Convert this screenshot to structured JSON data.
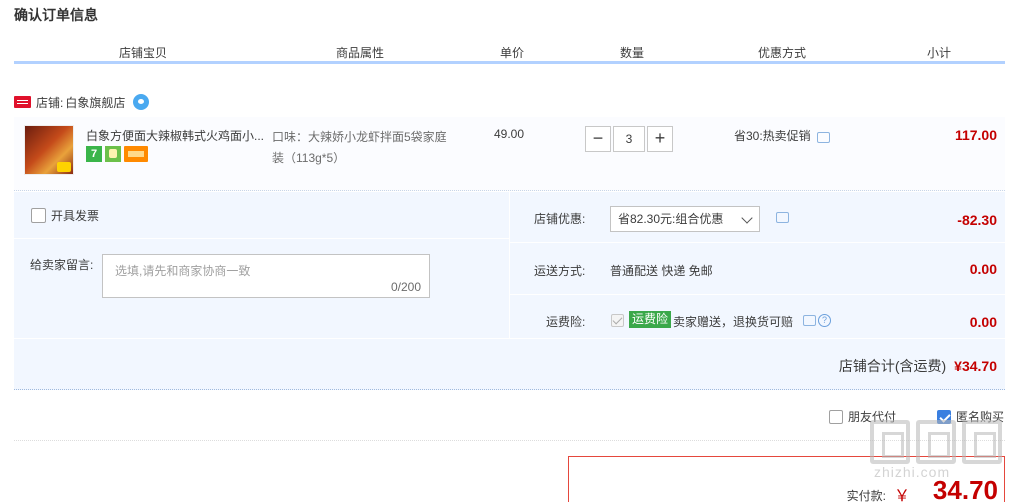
{
  "page": {
    "title": "确认订单信息"
  },
  "columns": [
    "店铺宝贝",
    "商品属性",
    "单价",
    "数量",
    "优惠方式",
    "小计"
  ],
  "shop": {
    "label": "店铺:",
    "name": "白象旗舰店",
    "badge_icon": "tmall-icon",
    "chat_icon": "wangwang-icon"
  },
  "item": {
    "title": "白象方便面大辣椒韩式火鸡面小...",
    "attribute": "口味：大辣娇小龙虾拌面5袋家庭装（113g*5）",
    "price": "49.00",
    "quantity": "3",
    "minus": "−",
    "plus": "+",
    "promotion": "省30:热卖促销",
    "subtotal": "117.00",
    "badges": [
      "7",
      "gift-icon",
      "card-icon"
    ]
  },
  "invoice": {
    "label": "开具发票",
    "checked": false
  },
  "message": {
    "label": "给卖家留言:",
    "placeholder": "选填,请先和商家协商一致",
    "counter": "0/200"
  },
  "shop_discount": {
    "label": "店铺优惠:",
    "selected": "省82.30元:组合优惠",
    "amount": "-82.30"
  },
  "shipping": {
    "label": "运送方式:",
    "value": "普通配送 快递 免邮",
    "amount": "0.00"
  },
  "insurance": {
    "label": "运费险:",
    "tag": "运费险",
    "text": "卖家赠送，退换货可赔",
    "amount": "0.00",
    "help": "?"
  },
  "shop_total": {
    "label": "店铺合计(含运费)",
    "amount": "¥34.70"
  },
  "options": {
    "friend_pay": "朋友代付",
    "anonymous": "匿名购买",
    "anonymous_checked": true
  },
  "payment": {
    "label": "实付款:",
    "currency": "￥",
    "amount": "34.70"
  },
  "watermark": {
    "text": "zhizhi.com"
  },
  "colors": {
    "accent_red": "#c40000",
    "header_border": "#b2d1ff",
    "panel_bg": "#f2f7ff",
    "tag_green": "#3aa84a"
  }
}
